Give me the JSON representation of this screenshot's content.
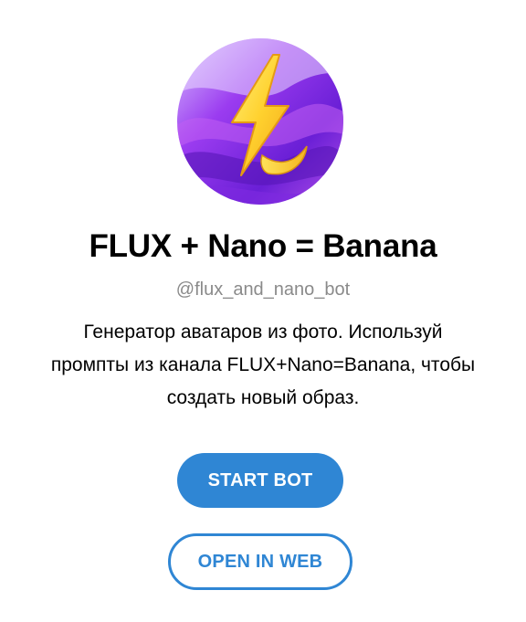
{
  "bot": {
    "title": "FLUX + Nano = Banana",
    "handle": "@flux_and_nano_bot",
    "description_lines": [
      "Генератор аватаров из фото. Используй",
      "промпты из канала FLUX+Nano=Banana, чтобы",
      "создать новый образ."
    ],
    "avatar_icon": "lightning-banana-icon"
  },
  "actions": {
    "start_label": "START BOT",
    "open_web_label": "OPEN IN WEB"
  },
  "colors": {
    "accent": "#2f86d4",
    "handle_gray": "#8a8a8a",
    "avatar_purple": "#8a2be2",
    "bolt_yellow": "#ffcc2f"
  }
}
